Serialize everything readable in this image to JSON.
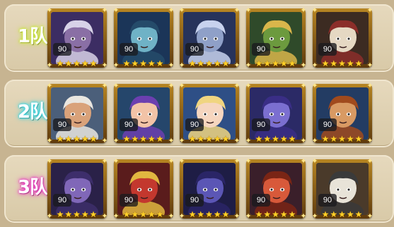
{
  "teams": [
    {
      "label": "1队",
      "glow": "#c9e63a",
      "heroes": [
        {
          "name": "dark-elf-hero",
          "level": "90",
          "stars": 5,
          "skin": "#8a6fa5",
          "hair": "#d8d2e8",
          "bg": "#3c2d63"
        },
        {
          "name": "medusa-hero",
          "level": "90",
          "stars": 5,
          "skin": "#6fb2c6",
          "hair": "#254b6a",
          "bg": "#1b3558"
        },
        {
          "name": "werewolf-hero",
          "level": "90",
          "stars": 5,
          "skin": "#8fa0c8",
          "hair": "#c8d2ee",
          "bg": "#27335b"
        },
        {
          "name": "lizard-king-hero",
          "level": "90",
          "stars": 5,
          "skin": "#6c9a3e",
          "hair": "#d9b64b",
          "bg": "#2f4a2a"
        },
        {
          "name": "skeleton-hero",
          "level": "90",
          "stars": 5,
          "skin": "#e5d8c3",
          "hair": "#8b2e2a",
          "bg": "#3c2b22"
        }
      ]
    },
    {
      "label": "2队",
      "glow": "#36d6e6",
      "heroes": [
        {
          "name": "old-sage-hero",
          "level": "90",
          "stars": 5,
          "skin": "#d9a27a",
          "hair": "#e9e6e0",
          "bg": "#4b5f7a"
        },
        {
          "name": "archer-girl-hero",
          "level": "90",
          "stars": 5,
          "skin": "#f2c3a7",
          "hair": "#6c3fb0",
          "bg": "#25466b"
        },
        {
          "name": "priestess-hero",
          "level": "90",
          "stars": 5,
          "skin": "#f6d6bf",
          "hair": "#f0d580",
          "bg": "#2e4f86"
        },
        {
          "name": "night-elf-hero",
          "level": "90",
          "stars": 5,
          "skin": "#7b6fd0",
          "hair": "#3a2e86",
          "bg": "#2b2a66"
        },
        {
          "name": "dwarf-warrior-hero",
          "level": "90",
          "stars": 5,
          "skin": "#d89a63",
          "hair": "#a04a1d",
          "bg": "#233c63"
        }
      ]
    },
    {
      "label": "3队",
      "glow": "#e83ac2",
      "heroes": [
        {
          "name": "shadow-assassin-hero",
          "level": "90",
          "stars": 5,
          "skin": "#8067b8",
          "hair": "#3d2e6b",
          "bg": "#2a2148"
        },
        {
          "name": "red-knight-hero",
          "level": "90",
          "stars": 5,
          "skin": "#c3382e",
          "hair": "#e1b640",
          "bg": "#5a1c1c"
        },
        {
          "name": "cerberus-hero",
          "level": "90",
          "stars": 5,
          "skin": "#5b56b5",
          "hair": "#2a2566",
          "bg": "#1e1d45"
        },
        {
          "name": "red-goblin-hero",
          "level": "90",
          "stars": 5,
          "skin": "#d8593a",
          "hair": "#7a2515",
          "bg": "#3a1f2a"
        },
        {
          "name": "panda-monk-hero",
          "level": "90",
          "stars": 5,
          "skin": "#e8e3d8",
          "hair": "#3a3a3a",
          "bg": "#4a3a2a"
        }
      ]
    }
  ]
}
